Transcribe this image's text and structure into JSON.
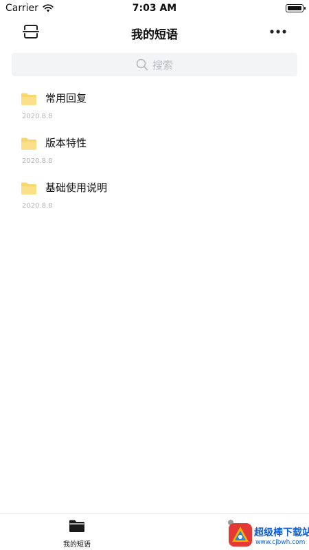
{
  "status_bar": {
    "carrier": "Carrier",
    "time": "7:03 AM",
    "battery_level": 1.0
  },
  "nav": {
    "title": "我的短语",
    "left_icon": "scan-icon",
    "right_icon": "more-icon"
  },
  "search": {
    "placeholder": "搜索",
    "icon": "search-icon"
  },
  "phrases": [
    {
      "title": "常用回复",
      "date": "2020.8.8",
      "icon": "folder-icon"
    },
    {
      "title": "版本特性",
      "date": "2020.8.8",
      "icon": "folder-icon"
    },
    {
      "title": "基础使用说明",
      "date": "2020.8.8",
      "icon": "folder-icon"
    }
  ],
  "tab_bar": {
    "tabs": [
      {
        "label": "我的短语",
        "icon": "folder-filled-icon",
        "active": true
      },
      {
        "label": "",
        "icon": "profile-icon",
        "active": false
      }
    ]
  },
  "watermark": {
    "text": "超级棒下载站",
    "url": "www.cjbwh.com"
  },
  "colors": {
    "folder": "#f9d66b",
    "search_bg": "#f3f4f6",
    "watermark": "#0f5fd6"
  }
}
